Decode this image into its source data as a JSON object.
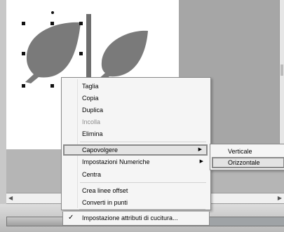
{
  "context_menu": {
    "items": [
      {
        "label": "Taglia",
        "disabled": false
      },
      {
        "label": "Copia",
        "disabled": false
      },
      {
        "label": "Duplica",
        "disabled": false
      },
      {
        "label": "Incolla",
        "disabled": true
      },
      {
        "label": "Elimina",
        "disabled": false
      },
      {
        "label": "Capovolgere",
        "submenu": true,
        "highlighted": true
      },
      {
        "label": "Impostazioni Numeriche",
        "submenu": true
      },
      {
        "label": "Centra",
        "disabled": false
      },
      {
        "label": "Crea linee offset",
        "disabled": false
      },
      {
        "label": "Converti in punti",
        "disabled": false
      },
      {
        "label": "Impostazione attributi di cucitura...",
        "checked": true
      }
    ],
    "check_glyph": "✓",
    "arrow_glyph": "▶"
  },
  "flip_submenu": {
    "items": [
      {
        "label": "Verticale"
      },
      {
        "label": "Orizzontale",
        "highlighted": true
      }
    ]
  },
  "canvas": {
    "shape_color": "#7a7a7a",
    "divider_color": "#6e6e6e"
  }
}
